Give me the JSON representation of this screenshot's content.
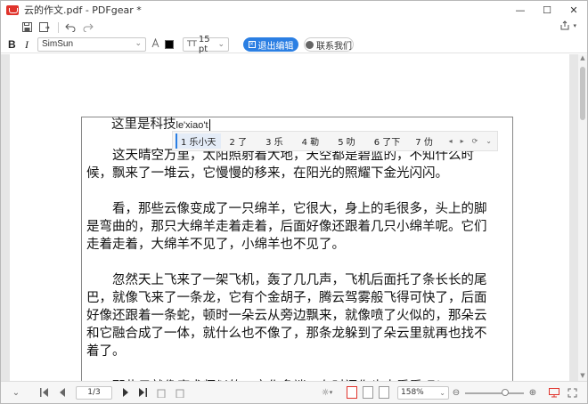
{
  "window": {
    "title": "云的作文.pdf - PDFgear *",
    "minimize": "—",
    "maximize": "☐",
    "close": "✕"
  },
  "toolbar": {
    "save_icon": "save-icon",
    "save_as_icon": "save-as-icon",
    "undo_icon": "undo-icon",
    "redo_icon": "redo-icon",
    "share_icon": "share-icon"
  },
  "format_bar": {
    "bold": "B",
    "italic": "I",
    "font_name": "SimSun",
    "font_color": "#000000",
    "font_size": "15 pt",
    "font_size_icon": "TT",
    "exit_edit_label": "退出编辑",
    "contact_label": "联系我们"
  },
  "document": {
    "title_text": "这里是科技",
    "pinyin_input": "le'xiao't",
    "paragraphs": [
      [
        "这天晴空万里，太阳照射着大地，天空都是碧蓝的，不知什么时",
        "候，飘来了一堆云，它慢慢的移来，在阳光的照耀下金光闪闪。"
      ],
      [
        "看，那些云像变成了一只绵羊，它很大，身上的毛很多，头上的脚",
        "是弯曲的，那只大绵羊走着走着，后面好像还跟着几只小绵羊呢。它们",
        "走着走着，大绵羊不见了，小绵羊也不见了。"
      ],
      [
        "忽然天上飞来了一架飞机，轰了几几声，飞机后面托了条长长的尾",
        "巴，就像飞来了一条龙，它有个金胡子，腾云驾雾般飞得可快了，后面",
        "好像还跟着一条蛇，顿时一朵云从旁边飘来，就像喷了火似的，那朵云",
        "和它融合成了一体，就什么也不像了，那条龙躲到了朵云里就再也找不",
        "着了。"
      ],
      [
        "那些云就像魔术师似的，变化多端。有时间你也去看看吧！"
      ]
    ]
  },
  "ime": {
    "candidates": [
      "1 乐小天",
      "2 了",
      "3 乐",
      "4 勒",
      "5 叻",
      "6 了下",
      "7 仂"
    ],
    "nav": [
      "◂",
      "▸",
      "⟳",
      "⌄"
    ]
  },
  "statusbar": {
    "page_indicator": "1/3",
    "zoom_value": "158%"
  }
}
